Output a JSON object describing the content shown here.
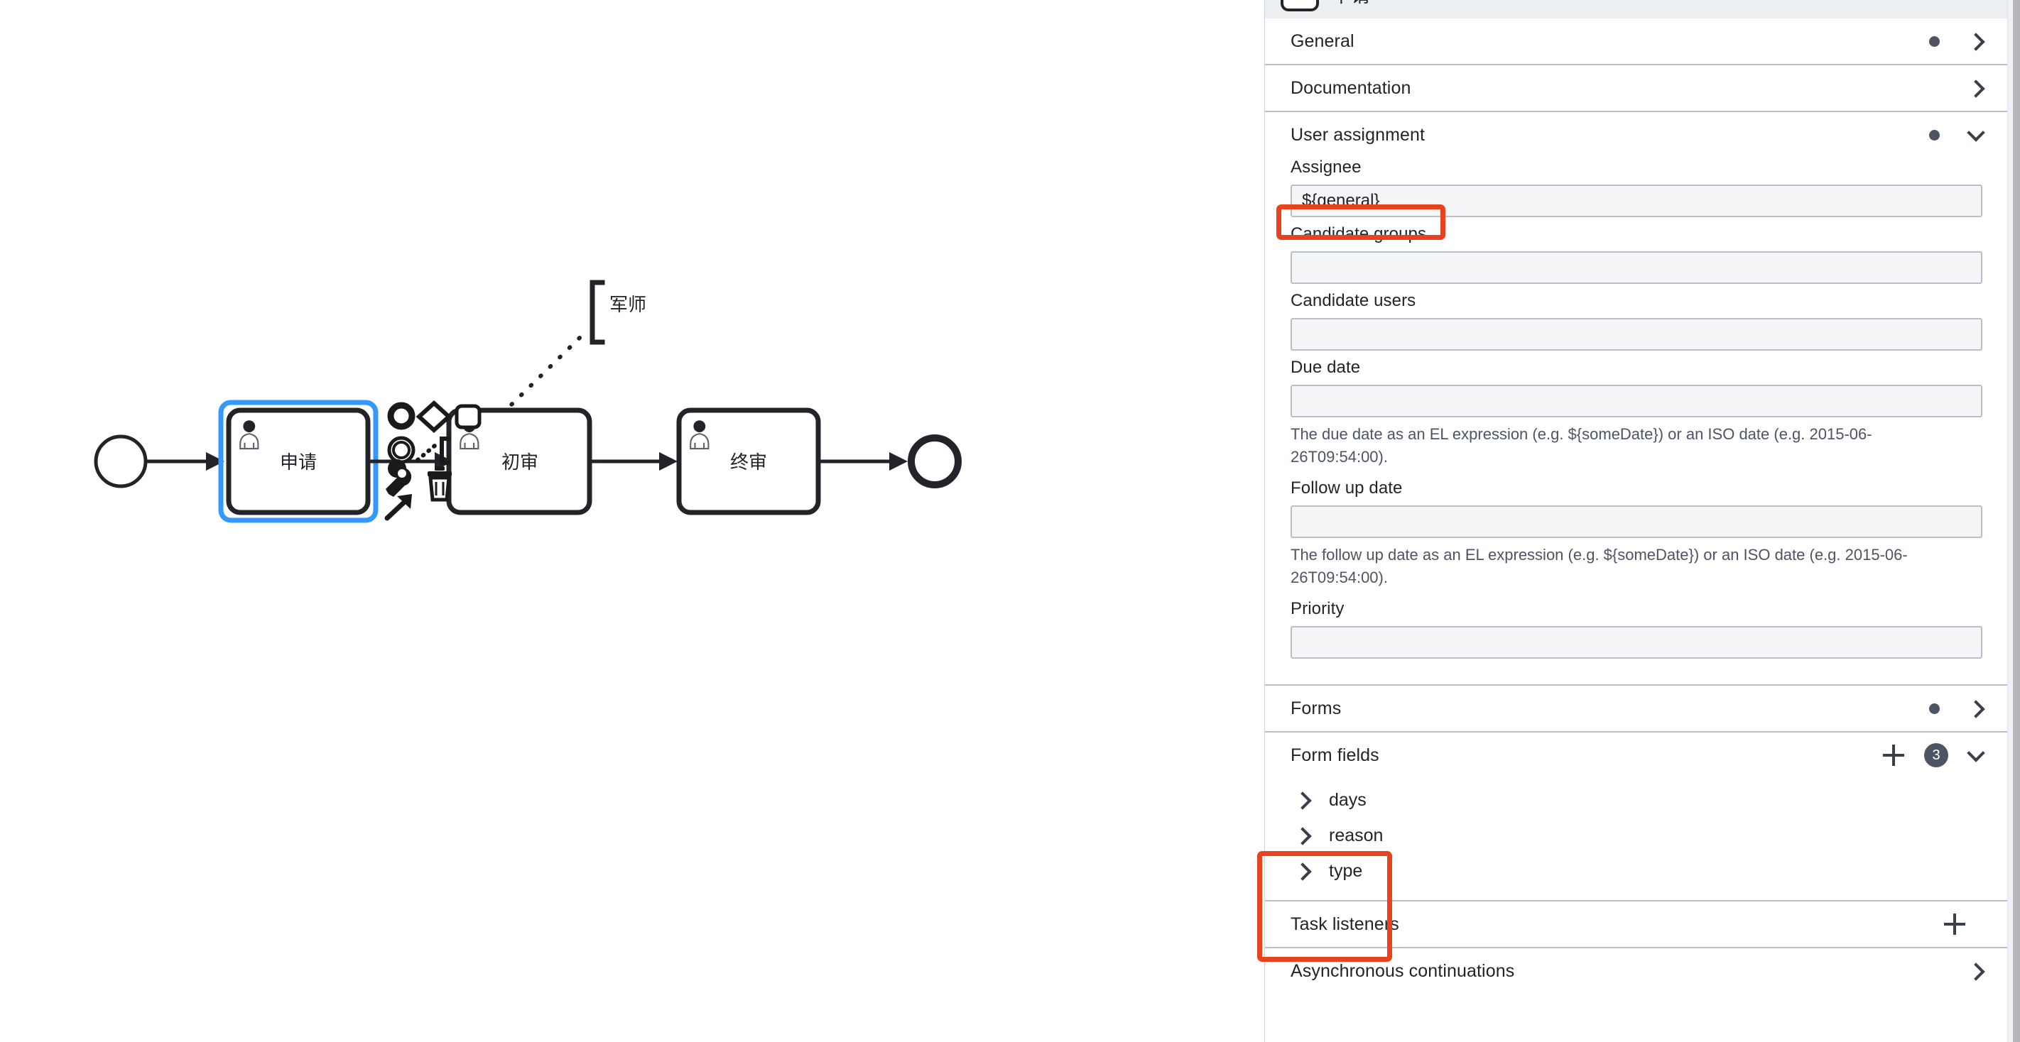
{
  "canvas": {
    "diagram_type": "bpmn",
    "elements": {
      "start_event": {
        "name": "start-event",
        "label": ""
      },
      "task_1": {
        "label": "申请",
        "type": "user-task",
        "selected": true
      },
      "task_2": {
        "label": "初审",
        "type": "user-task",
        "selected": false
      },
      "task_3": {
        "label": "终审",
        "type": "user-task",
        "selected": false
      },
      "end_event": {
        "name": "end-event",
        "label": ""
      },
      "text_annotation": {
        "label": "军师"
      }
    },
    "context_pad": {
      "items": [
        {
          "name": "append-end-event-icon",
          "glyph": "circle-thick"
        },
        {
          "name": "append-gateway-icon",
          "glyph": "diamond"
        },
        {
          "name": "append-task-icon",
          "glyph": "rounded-rect"
        },
        {
          "name": "append-intermediate-event-icon",
          "glyph": "double-circle"
        },
        {
          "name": "append-text-annotation-icon",
          "glyph": "bracket-dotted"
        },
        {
          "name": "replace-wrench-icon",
          "glyph": "wrench"
        },
        {
          "name": "delete-icon",
          "glyph": "trash"
        },
        {
          "name": "connect-icon",
          "glyph": "arrow"
        }
      ]
    }
  },
  "panel": {
    "element_header": {
      "label": "申请",
      "icon": "user-task-icon"
    },
    "groups": [
      {
        "id": "general",
        "title": "General",
        "dot": true,
        "expanded": false
      },
      {
        "id": "documentation",
        "title": "Documentation",
        "dot": false,
        "expanded": false
      },
      {
        "id": "user_assignment",
        "title": "User assignment",
        "dot": true,
        "expanded": true
      },
      {
        "id": "forms",
        "title": "Forms",
        "dot": true,
        "expanded": false
      },
      {
        "id": "form_fields",
        "title": "Form fields",
        "dot": false,
        "expanded": true,
        "badge": "3",
        "plus": true
      },
      {
        "id": "task_listeners",
        "title": "Task listeners",
        "dot": false,
        "expanded": false,
        "plus": true
      },
      {
        "id": "async_continuations",
        "title": "Asynchronous continuations",
        "dot": false,
        "expanded": false
      }
    ],
    "user_assignment": {
      "assignee": {
        "label": "Assignee",
        "value": "${general}",
        "placeholder": ""
      },
      "candidate_groups": {
        "label": "Candidate groups",
        "value": "",
        "placeholder": ""
      },
      "candidate_users": {
        "label": "Candidate users",
        "value": "",
        "placeholder": ""
      },
      "due_date": {
        "label": "Due date",
        "value": "",
        "placeholder": "",
        "hint": "The due date as an EL expression (e.g. ${someDate}) or an ISO date (e.g. 2015-06-26T09:54:00)."
      },
      "follow_up_date": {
        "label": "Follow up date",
        "value": "",
        "placeholder": "",
        "hint": "The follow up date as an EL expression (e.g. ${someDate}) or an ISO date (e.g. 2015-06-26T09:54:00)."
      },
      "priority": {
        "label": "Priority",
        "value": "",
        "placeholder": ""
      }
    },
    "form_fields": {
      "count": "3",
      "items": [
        {
          "name": "days"
        },
        {
          "name": "reason"
        },
        {
          "name": "type"
        }
      ]
    }
  },
  "annotations": {
    "color": "#e8421f",
    "boxes": [
      {
        "name": "assignee-highlight",
        "target": "assignee-input"
      },
      {
        "name": "form-fields-highlight",
        "target": "form-fields-list"
      }
    ]
  },
  "colors": {
    "accent_red": "#e8421f",
    "selection_blue": "#3399ff",
    "shape_stroke": "#22242a",
    "panel_border": "#b9bec9",
    "badge_bg": "#4d5464",
    "input_bg": "#f4f5f7"
  }
}
